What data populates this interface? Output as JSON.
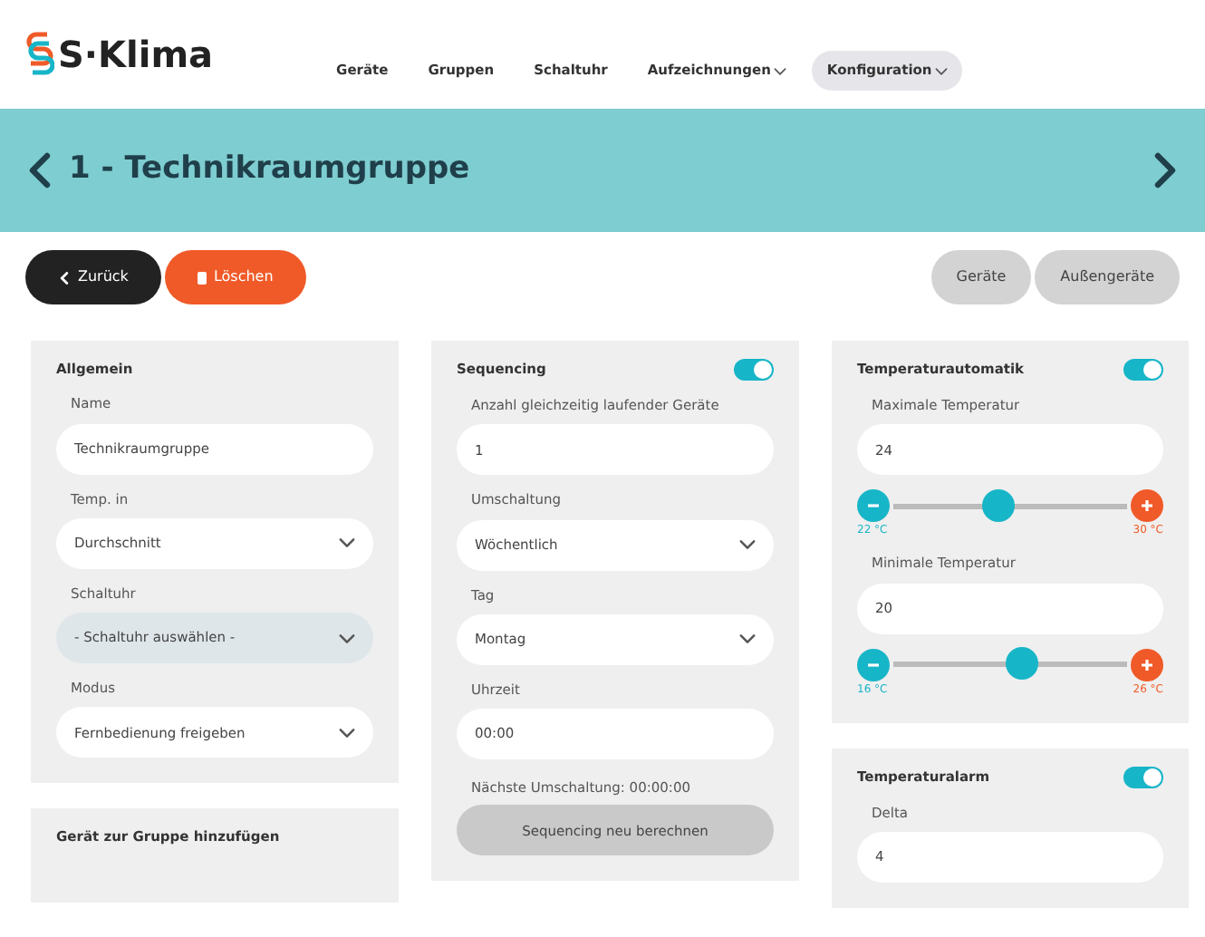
{
  "logo": {
    "text": "S·Klima"
  },
  "nav": [
    {
      "label": "Geräte",
      "dropdown": false,
      "selected": false
    },
    {
      "label": "Gruppen",
      "dropdown": false,
      "selected": false
    },
    {
      "label": "Schaltuhr",
      "dropdown": false,
      "selected": false
    },
    {
      "label": "Aufzeichnungen",
      "dropdown": true,
      "selected": false
    },
    {
      "label": "Konfiguration",
      "dropdown": true,
      "selected": true
    }
  ],
  "title_bar": {
    "title": "1 - Technikraumgruppe"
  },
  "actions_left": [
    {
      "label": "Zurück",
      "kind": "back"
    },
    {
      "label": "Löschen",
      "kind": "delete"
    }
  ],
  "actions_right": [
    {
      "label": "Geräte"
    },
    {
      "label": "Außengeräte"
    }
  ],
  "columns": [
    [
      {
        "title": "Allgemein",
        "fields": [
          {
            "kind": "input",
            "label": "Name",
            "value": "Technikraumgruppe"
          },
          {
            "kind": "select",
            "label": "Temp. in",
            "value": "Durchschnitt",
            "focused": false
          },
          {
            "kind": "select",
            "label": "Schaltuhr",
            "value": "- Schaltuhr auswählen -",
            "focused": true
          },
          {
            "kind": "select",
            "label": "Modus",
            "value": "Fernbedienung freigeben",
            "focused": false
          }
        ]
      },
      {
        "title": "Gerät zur Gruppe hinzufügen"
      }
    ],
    [
      {
        "title": "Sequencing",
        "toggle": {
          "on": true
        },
        "fields": [
          {
            "kind": "input",
            "label": "Anzahl gleichzeitig laufender Geräte",
            "value": "1"
          },
          {
            "kind": "select",
            "label": "Umschaltung",
            "value": "Wöchentlich",
            "focused": false
          },
          {
            "kind": "select",
            "label": "Tag",
            "value": "Montag",
            "focused": false
          },
          {
            "kind": "input",
            "label": "Uhrzeit",
            "value": "00:00"
          },
          {
            "kind": "note",
            "text": "Nächste Umschaltung: 00:00:00"
          },
          {
            "kind": "button",
            "text": "Sequencing neu berechnen"
          }
        ]
      }
    ],
    [
      {
        "title": "Temperaturautomatik",
        "toggle": {
          "on": true
        },
        "fields": [
          {
            "kind": "input",
            "label": "Maximale Temperatur",
            "value": "24"
          },
          {
            "kind": "slider",
            "level": 0.45,
            "min": "22 °C",
            "max": "30 °C"
          },
          {
            "kind": "input",
            "label": "Minimale Temperatur",
            "value": "20"
          },
          {
            "kind": "slider",
            "level": 0.55,
            "min": "16 °C",
            "max": "26 °C"
          }
        ]
      },
      {
        "title": "Temperaturalarm",
        "toggle": {
          "on": true
        },
        "fields": [
          {
            "kind": "input",
            "label": "Delta",
            "value": "4"
          }
        ]
      }
    ]
  ]
}
